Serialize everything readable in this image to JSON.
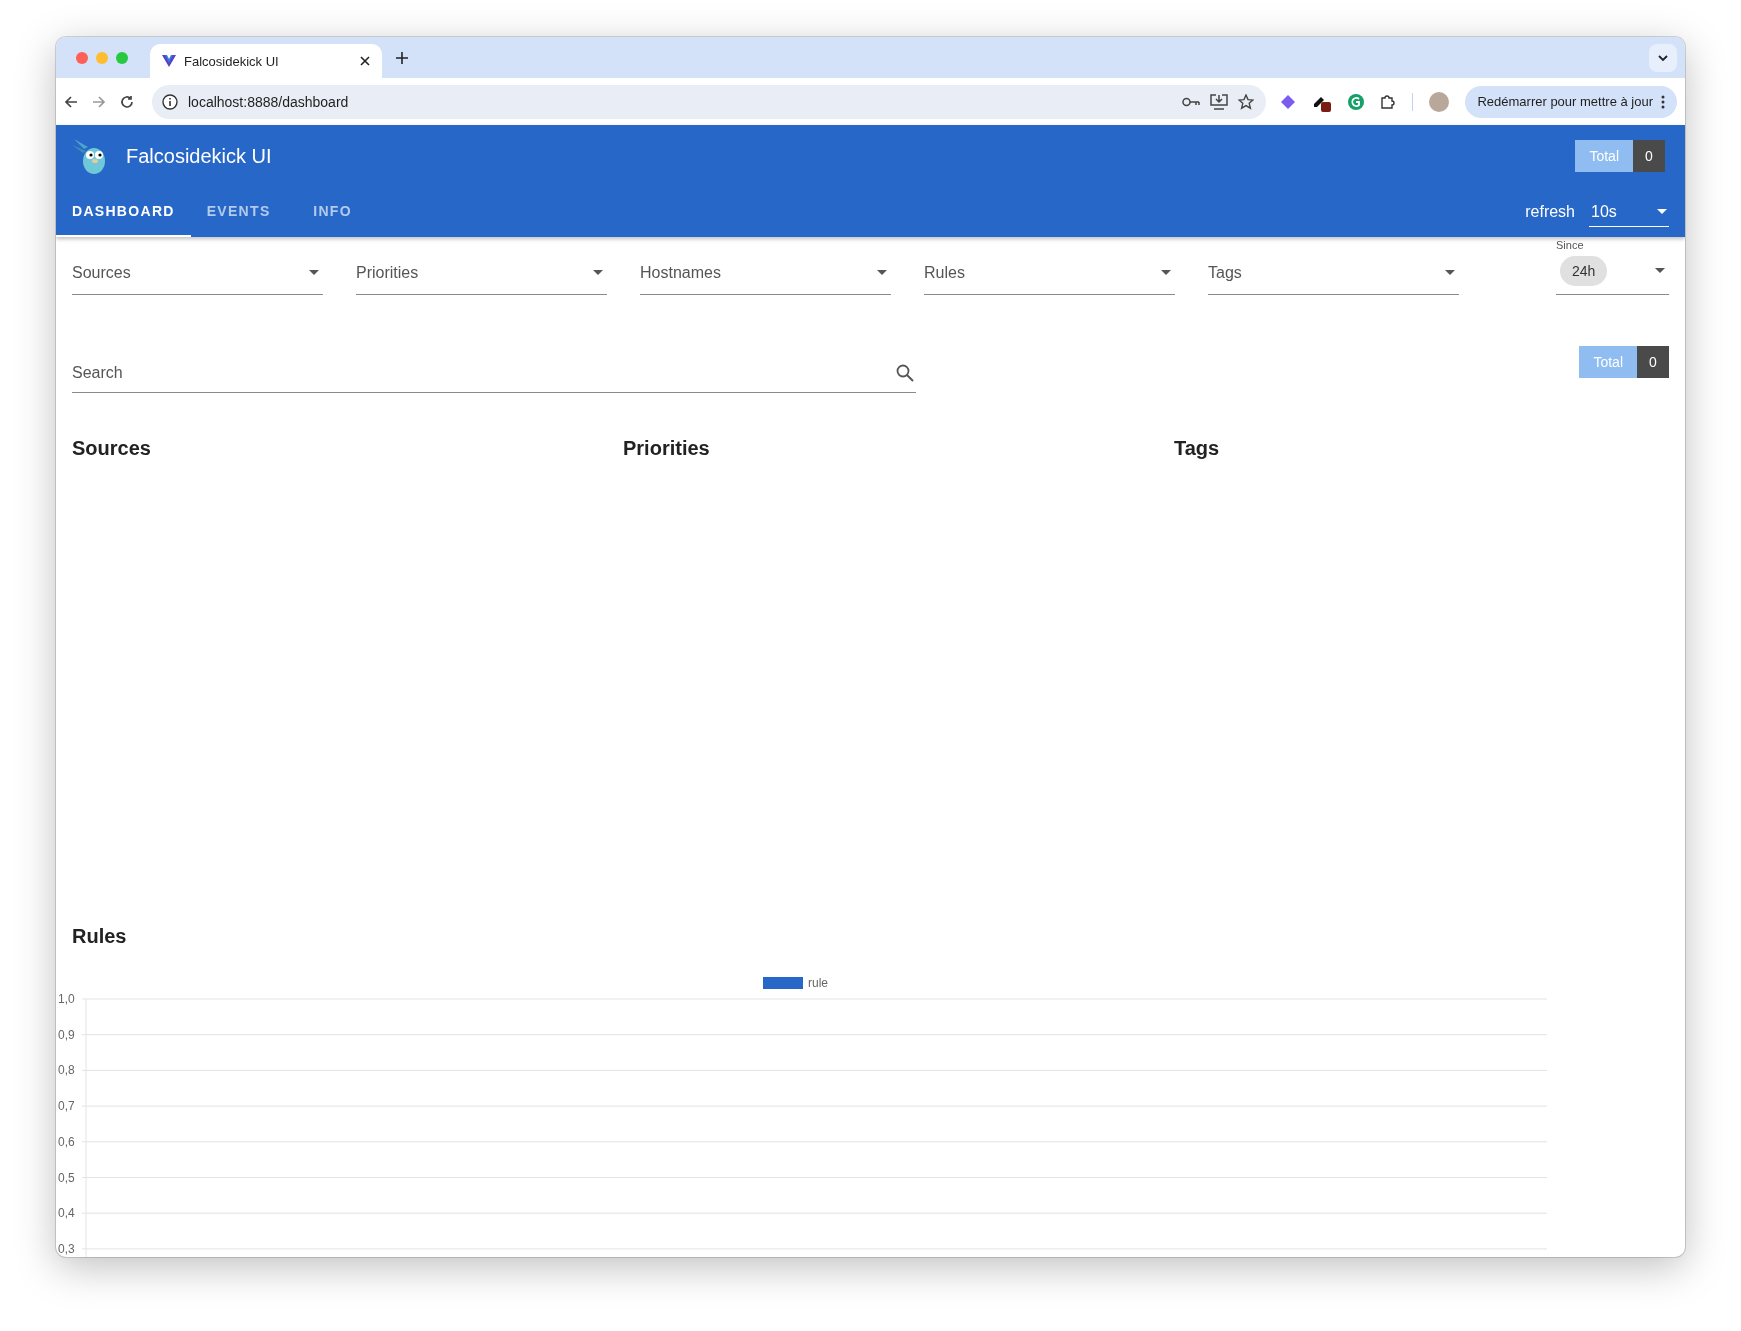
{
  "browser": {
    "tab_title": "Falcosidekick UI",
    "url": "localhost:8888/dashboard",
    "restart_button": "Redémarrer pour mettre à jour"
  },
  "header": {
    "title": "Falcosidekick UI",
    "total_label": "Total",
    "total_value": "0",
    "tabs": [
      {
        "label": "DASHBOARD",
        "selected": true
      },
      {
        "label": "EVENTS",
        "selected": false
      },
      {
        "label": "INFO",
        "selected": false
      }
    ],
    "refresh_label": "refresh",
    "refresh_value": "10s"
  },
  "filters": [
    {
      "label": "Sources"
    },
    {
      "label": "Priorities"
    },
    {
      "label": "Hostnames"
    },
    {
      "label": "Rules"
    },
    {
      "label": "Tags"
    }
  ],
  "since": {
    "label": "Since",
    "value": "24h"
  },
  "search": {
    "placeholder": "Search"
  },
  "total": {
    "label": "Total",
    "value": "0"
  },
  "sections": [
    "Sources",
    "Priorities",
    "Tags"
  ],
  "rules": {
    "title": "Rules",
    "chart_data": {
      "type": "bar",
      "series": [
        {
          "name": "rule",
          "color": "#2767c8"
        }
      ],
      "ylim": [
        0.3,
        1.0
      ],
      "grid": true,
      "yticks": [
        {
          "value": 1.0,
          "label": "1,0"
        },
        {
          "value": 0.9,
          "label": "0,9"
        },
        {
          "value": 0.8,
          "label": "0,8"
        },
        {
          "value": 0.7,
          "label": "0,7"
        },
        {
          "value": 0.6,
          "label": "0,6"
        },
        {
          "value": 0.5,
          "label": "0,5"
        },
        {
          "value": 0.4,
          "label": "0,4"
        },
        {
          "value": 0.3,
          "label": "0,3"
        }
      ]
    }
  }
}
